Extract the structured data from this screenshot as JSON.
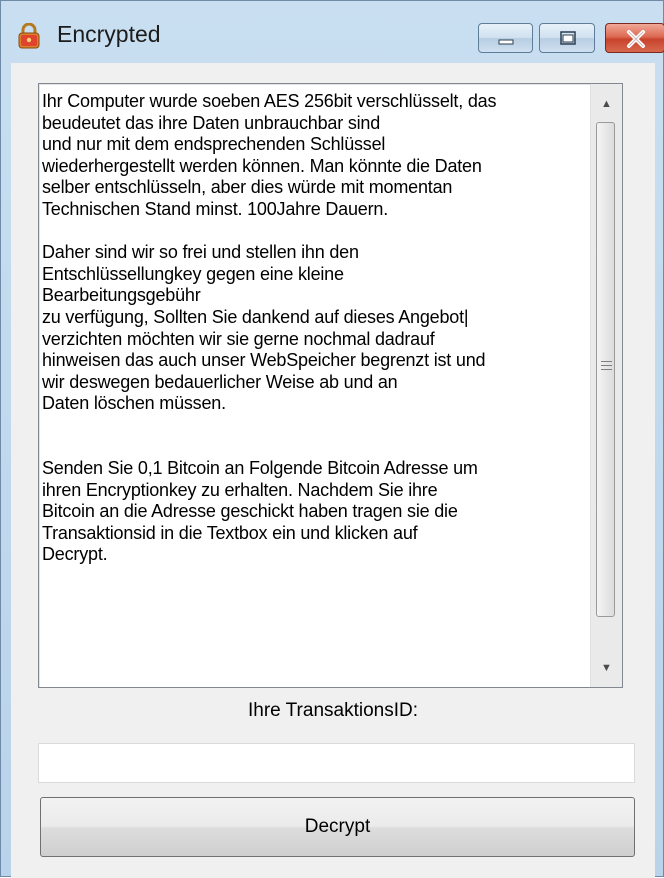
{
  "window": {
    "title": "Encrypted",
    "icon": "lock-icon"
  },
  "controls": {
    "minimize_icon": "minimize-icon",
    "maximize_icon": "maximize-icon",
    "close_icon": "close-icon"
  },
  "message": {
    "text": "Ihr Computer wurde soeben AES 256bit verschlüsselt, das\nbeudeutet das ihre Daten unbrauchbar sind\nund nur mit dem endsprechenden Schlüssel\nwiederhergestellt werden können. Man könnte die Daten\nselber entschlüsseln, aber dies würde mit momentan\nTechnischen Stand minst. 100Jahre Dauern.\n\nDaher sind wir so frei und stellen ihn den\nEntschlüssellungkey gegen eine kleine\nBearbeitungsgebühr\nzu verfügung, Sollten Sie dankend auf dieses Angebot|\nverzichten möchten wir sie gerne nochmal dadrauf\nhinweisen das auch unser WebSpeicher begrenzt ist und\nwir deswegen bedauerlicher Weise ab und an\nDaten löschen müssen.\n\n\nSenden Sie 0,1 Bitcoin an Folgende Bitcoin Adresse um\nihren Encryptionkey zu erhalten. Nachdem Sie ihre\nBitcoin an die Adresse geschickt haben tragen sie die\nTransaktionsid in die Textbox ein und klicken auf\nDecrypt."
  },
  "scrollbar": {
    "up_icon": "scroll-up-arrow-icon",
    "down_icon": "scroll-down-arrow-icon"
  },
  "transaction": {
    "label": "Ihre TransaktionsID:",
    "value": ""
  },
  "decrypt_button": {
    "label": "Decrypt"
  },
  "colors": {
    "frame": "#c9dff1",
    "client": "#f0f0f0",
    "close_button": "#c8432c"
  }
}
